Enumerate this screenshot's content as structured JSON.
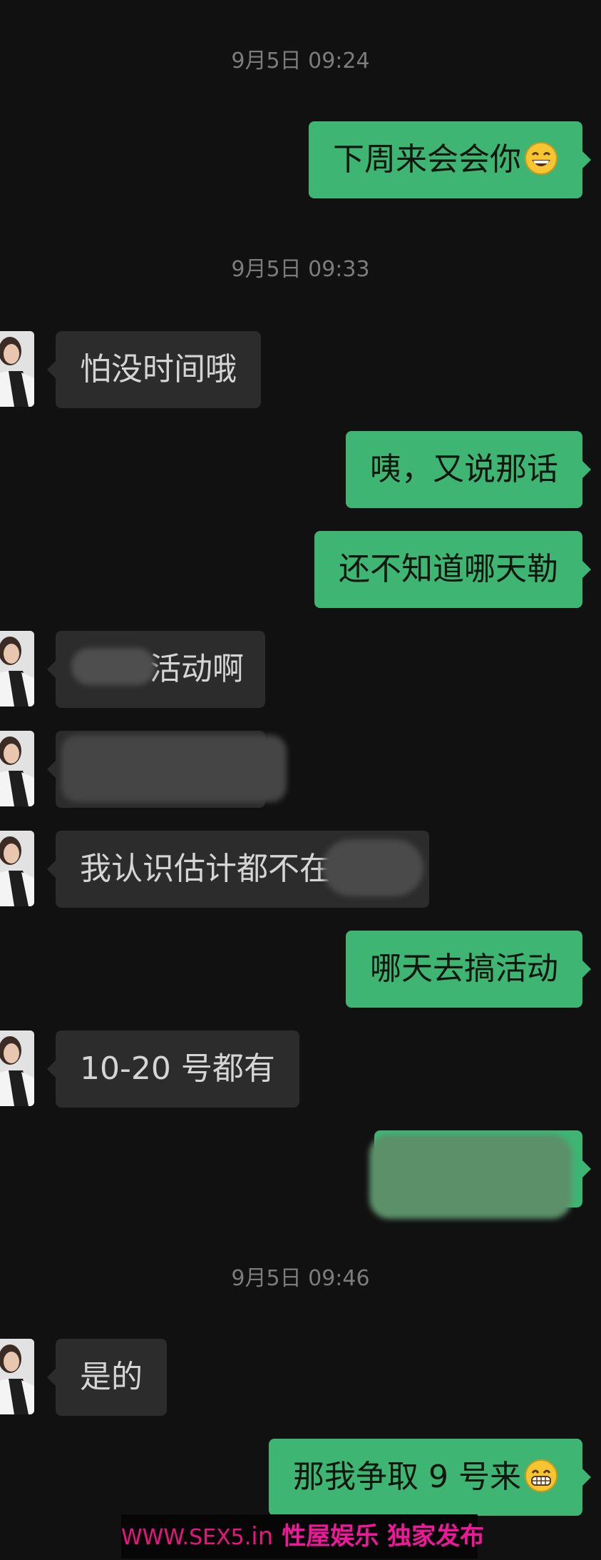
{
  "timestamps": [
    "9月5日 09:24",
    "9月5日 09:33",
    "9月5日 09:46"
  ],
  "messages": {
    "m1": "下周来会会你",
    "m2": "怕没时间哦",
    "m3": "咦，又说那话",
    "m4": "还不知道哪天勒",
    "m5": "活动啊",
    "m6": "",
    "m7": "我认识估计都不在",
    "m8": "哪天去搞活动",
    "m9": "10-20 号都有",
    "m10": "",
    "m11": "是的",
    "m12": "那我争取 9 号来"
  },
  "emojis": {
    "m1": "grinning-face-emoji",
    "m12": "grinning-teeth-emoji"
  },
  "colors": {
    "background": "#111111",
    "incoming_bubble": "#2c2c2c",
    "outgoing_bubble": "#3eb573",
    "timestamp": "#7c7c7c",
    "watermark_text": "#e8157f"
  },
  "watermark": {
    "site": "WWW.SEX5.",
    "domain_suffix": "in",
    "text": "性屋娱乐 独家发布"
  }
}
